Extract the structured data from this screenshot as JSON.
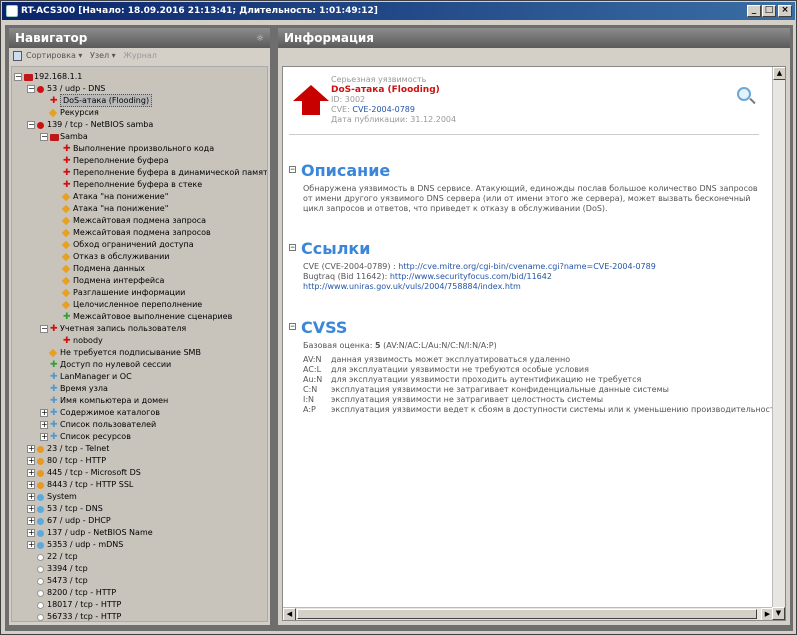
{
  "window": {
    "title": "RT-ACS300 [Начало: 18.09.2016 21:13:41; Длительность: 1:01:49:12]",
    "min": "_",
    "max": "□",
    "close": "×"
  },
  "nav": {
    "title": "Навигатор",
    "gear": "☼",
    "toolbar": {
      "sort": "Сортировка ▾",
      "node": "Узел ▾",
      "journal": "Журнал"
    }
  },
  "tree": [
    {
      "label": "192.168.1.1",
      "icon": "c-box",
      "exp": "−"
    },
    {
      "label": "53 / udp - DNS",
      "icon": "c-red",
      "exp": "−"
    },
    {
      "label": "DoS-атака (Flooding)",
      "icon": "c-plus-red",
      "exp": "",
      "sel": true
    },
    {
      "label": "Рекурсия",
      "icon": "c-diam-o",
      "exp": ""
    },
    {
      "label": "139 / tcp - NetBIOS samba",
      "icon": "c-red",
      "exp": "−"
    },
    {
      "label": "Samba",
      "icon": "c-box",
      "exp": "−"
    },
    {
      "label": "Выполнение произвольного кода",
      "icon": "c-plus-red",
      "exp": ""
    },
    {
      "label": "Переполнение буфера",
      "icon": "c-plus-red",
      "exp": ""
    },
    {
      "label": "Переполнение буфера в динамической памяти",
      "icon": "c-plus-red",
      "exp": ""
    },
    {
      "label": "Переполнение буфера в стеке",
      "icon": "c-plus-red",
      "exp": ""
    },
    {
      "label": "Атака \"на понижение\"",
      "icon": "c-diam-o",
      "exp": ""
    },
    {
      "label": "Атака \"на понижение\"",
      "icon": "c-diam-o",
      "exp": ""
    },
    {
      "label": "Межсайтовая подмена запроса",
      "icon": "c-diam-o",
      "exp": ""
    },
    {
      "label": "Межсайтовая подмена запросов",
      "icon": "c-diam-o",
      "exp": ""
    },
    {
      "label": "Обход ограничений доступа",
      "icon": "c-diam-o",
      "exp": ""
    },
    {
      "label": "Отказ в обслуживании",
      "icon": "c-diam-o",
      "exp": ""
    },
    {
      "label": "Подмена данных",
      "icon": "c-diam-o",
      "exp": ""
    },
    {
      "label": "Подмена интерфейса",
      "icon": "c-diam-o",
      "exp": ""
    },
    {
      "label": "Разглашение информации",
      "icon": "c-diam-o",
      "exp": ""
    },
    {
      "label": "Целочисленное переполнение",
      "icon": "c-diam-o",
      "exp": ""
    },
    {
      "label": "Межсайтовое выполнение сценариев",
      "icon": "c-plus-green",
      "exp": ""
    },
    {
      "label": "Учетная запись пользователя",
      "icon": "c-plus-red",
      "exp": "−"
    },
    {
      "label": "nobody",
      "icon": "c-plus-red",
      "exp": ""
    },
    {
      "label": "Не требуется подписывание SMB",
      "icon": "c-diam-o",
      "exp": ""
    },
    {
      "label": "Доступ по нулевой сессии",
      "icon": "c-plus-green",
      "exp": ""
    },
    {
      "label": "LanManager и ОС",
      "icon": "c-plus-blue",
      "exp": ""
    },
    {
      "label": "Время узла",
      "icon": "c-plus-blue",
      "exp": ""
    },
    {
      "label": "Имя компьютера и домен",
      "icon": "c-plus-blue",
      "exp": ""
    },
    {
      "label": "Содержимое каталогов",
      "icon": "c-plus-blue",
      "exp": "+"
    },
    {
      "label": "Список пользователей",
      "icon": "c-plus-blue",
      "exp": "+"
    },
    {
      "label": "Список ресурсов",
      "icon": "c-plus-blue",
      "exp": "+"
    },
    {
      "label": "23 / tcp - Telnet",
      "icon": "c-orange",
      "exp": "+"
    },
    {
      "label": "80 / tcp - HTTP",
      "icon": "c-orange",
      "exp": "+"
    },
    {
      "label": "445 / tcp - Microsoft DS",
      "icon": "c-orange",
      "exp": "+"
    },
    {
      "label": "8443 / tcp - HTTP SSL",
      "icon": "c-orange",
      "exp": "+"
    },
    {
      "label": "System",
      "icon": "c-blue",
      "exp": "+"
    },
    {
      "label": "53 / tcp - DNS",
      "icon": "c-blue",
      "exp": "+"
    },
    {
      "label": "67 / udp - DHCP",
      "icon": "c-blue",
      "exp": "+"
    },
    {
      "label": "137 / udp - NetBIOS Name",
      "icon": "c-blue",
      "exp": "+"
    },
    {
      "label": "5353 / udp - mDNS",
      "icon": "c-blue",
      "exp": "+"
    },
    {
      "label": "22 / tcp",
      "icon": "c-white",
      "exp": ""
    },
    {
      "label": "3394 / tcp",
      "icon": "c-white",
      "exp": ""
    },
    {
      "label": "5473 / tcp",
      "icon": "c-white",
      "exp": ""
    },
    {
      "label": "8200 / tcp - HTTP",
      "icon": "c-white",
      "exp": ""
    },
    {
      "label": "18017 / tcp - HTTP",
      "icon": "c-white",
      "exp": ""
    },
    {
      "label": "56733 / tcp - HTTP",
      "icon": "c-white",
      "exp": ""
    }
  ],
  "info": {
    "title": "Информация",
    "severity": "Серьезная уязвимость",
    "name": "DoS-атака (Flooding)",
    "id": "ID: 3002",
    "cve_label": "CVE: ",
    "cve": "CVE-2004-0789",
    "date": "Дата публикации: 31.12.2004",
    "desc_title": "Описание",
    "desc": "Обнаружена уязвимость в DNS сервисе. Атакующий, единожды послав большое количество DNS запросов от имени другого уязвимого DNS сервера (или от имени этого же сервера), может вызвать бесконечный цикл запросов и ответов, что приведет к отказу в обслуживании (DoS).",
    "links_title": "Ссылки",
    "link1_prefix": "CVE (CVE-2004-0789) : ",
    "link1": "http://cve.mitre.org/cgi-bin/cvename.cgi?name=CVE-2004-0789",
    "link2_prefix": "Bugtraq (Bid 11642): ",
    "link2": "http://www.securityfocus.com/bid/11642",
    "link3": "http://www.uniras.gov.uk/vuls/2004/758884/index.htm",
    "cvss_title": "CVSS",
    "cvss_base_label": "Базовая оценка: ",
    "cvss_base": "5",
    "cvss_vector": " (AV:N/AC:L/Au:N/C:N/I:N/A:P)",
    "cvss_rows": [
      {
        "k": "AV:N",
        "v": "данная уязвимость может эксплуатироваться удаленно"
      },
      {
        "k": "AC:L",
        "v": "для эксплуатации уязвимости не требуются особые условия"
      },
      {
        "k": "Au:N",
        "v": "для эксплуатации уязвимости проходить аутентификацию не требуется"
      },
      {
        "k": "C:N",
        "v": "эксплуатация уязвимости не затрагивает конфиденциальные данные системы"
      },
      {
        "k": "I:N",
        "v": "эксплуатация уязвимости не затрагивает целостность системы"
      },
      {
        "k": "A:P",
        "v": "эксплуатация уязвимости ведет к сбоям в доступности системы или к уменьшению производительности"
      }
    ]
  }
}
